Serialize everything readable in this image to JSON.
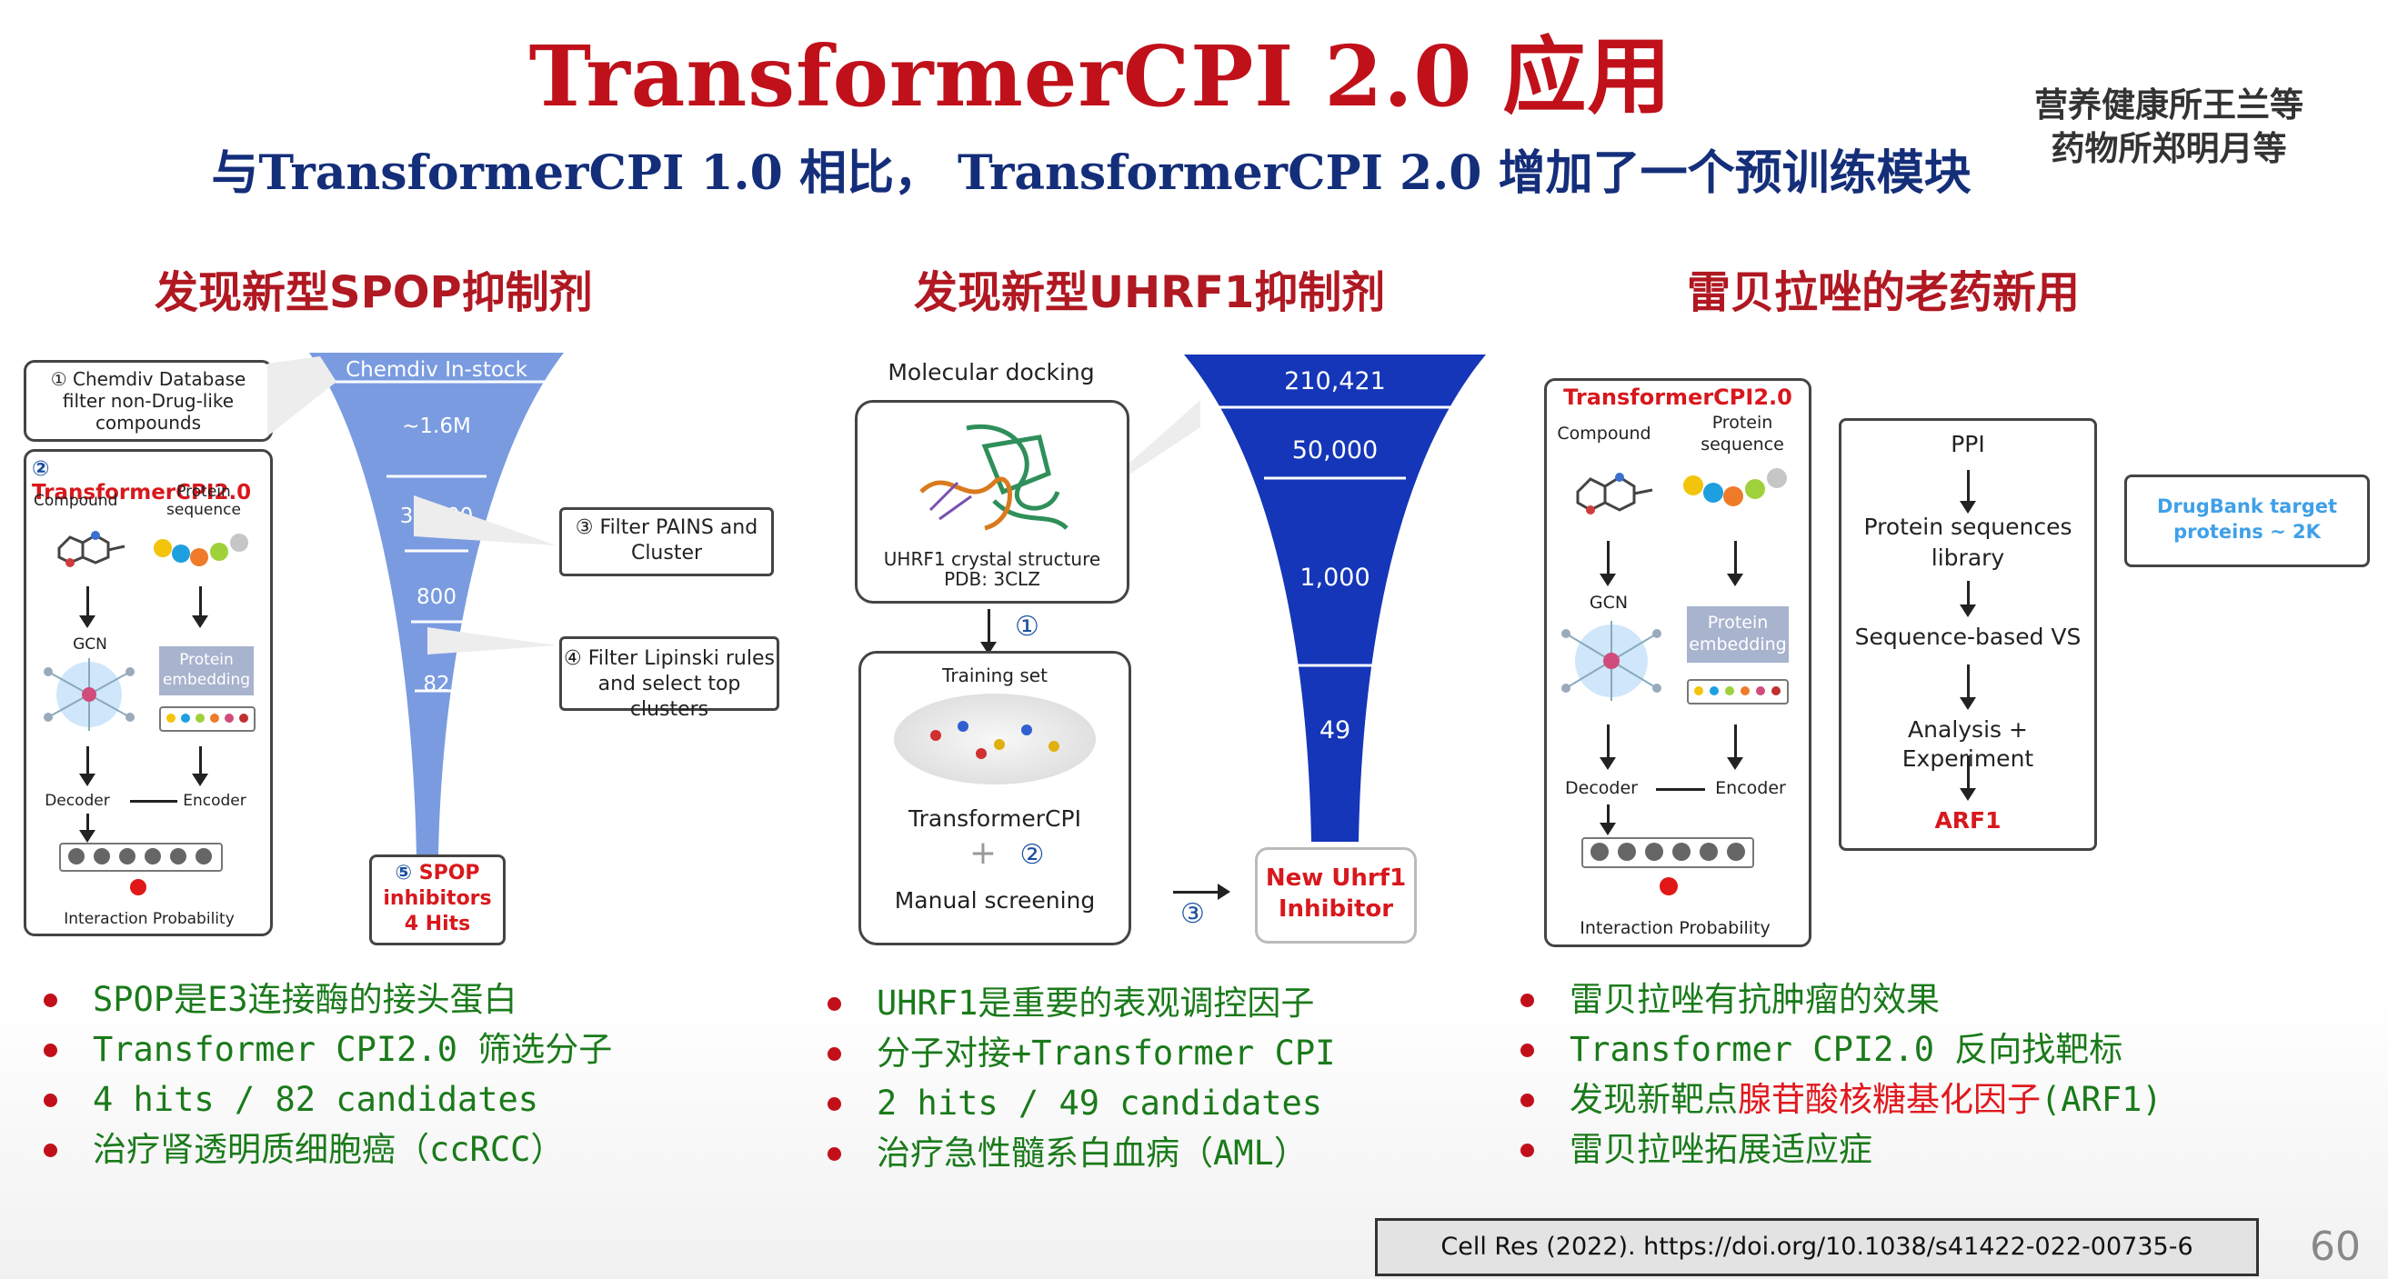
{
  "header": {
    "title": "TransformerCPI  2.0 应用",
    "authors_line1": "营养健康所王兰等",
    "authors_line2": "药物所郑明月等",
    "subtitle": "与TransformerCPI  1.0 相比，  TransformerCPI  2.0 增加了一个预训练模块"
  },
  "sections": {
    "s1": "发现新型SPOP抑制剂",
    "s2": "发现新型UHRF1抑制剂",
    "s3": "雷贝拉唑的老药新用"
  },
  "panel1": {
    "step1": "① Chemdiv Database filter non-Drug-like compounds",
    "step2_num": "②",
    "step2_label": "TransformerCPI2.0",
    "compound": "Compound",
    "protein_seq": "Protein sequence",
    "gcn": "GCN",
    "protein_embed": "Protein embedding",
    "decoder": "Decoder",
    "encoder": "Encoder",
    "interaction": "Interaction Probability",
    "funnel": [
      "Chemdiv In-stock",
      "~1.6M",
      "35,000",
      "800",
      "82"
    ],
    "step3": "③ Filter PAINS and Cluster",
    "step4": "④ Filter Lipinski rules and select top clusters",
    "step5_num": "⑤",
    "step5_label": "SPOP inhibitors",
    "step5_hits": "4 Hits"
  },
  "panel2": {
    "docking": "Molecular docking",
    "crystal": "UHRF1 crystal structure",
    "pdb": "PDB: 3CLZ",
    "n1": "①",
    "training": "Training set",
    "tcpi": "TransformerCPI",
    "plus": "+",
    "n2": "②",
    "manual": "Manual screening",
    "n3": "③",
    "funnel": [
      "210,421",
      "50,000",
      "1,000",
      "49"
    ],
    "result": "New Uhrf1 Inhibitor"
  },
  "panel3": {
    "label": "TransformerCPI2.0",
    "compound": "Compound",
    "protein_seq": "Protein sequence",
    "gcn": "GCN",
    "protein_embed": "Protein embedding",
    "decoder": "Decoder",
    "encoder": "Encoder",
    "interaction": "Interaction Probability",
    "flow": [
      "PPI",
      "Protein sequences library",
      "Sequence-based VS",
      "Analysis + Experiment",
      "ARF1"
    ],
    "drugbank": "DrugBank target proteins ~ 2K"
  },
  "bullets1": [
    "SPOP是E3连接酶的接头蛋白",
    "Transformer CPI2.0 筛选分子",
    "4 hits / 82 candidates",
    "治疗肾透明质细胞癌（ccRCC）"
  ],
  "bullets2": [
    "UHRF1是重要的表观调控因子",
    "分子对接+Transformer CPI",
    "2 hits / 49 candidates",
    "治疗急性髓系白血病（AML）"
  ],
  "bullets3": {
    "b1": "雷贝拉唑有抗肿瘤的效果",
    "b2": "Transformer CPI2.0 反向找靶标",
    "b3a": "发现新靶点",
    "b3b": "腺苷酸核糖基化因子",
    "b3c": "(ARF1)",
    "b4": "雷贝拉唑拓展适应症"
  },
  "footer": {
    "citation": "Cell Res (2022).    https://doi.org/10.1038/s41422-022-00735-6",
    "page": "60"
  },
  "colors": {
    "title": "#c0111b",
    "subtitle": "#142e7a",
    "bullet_text": "#1a7a1a",
    "funnel_light": "#7a9be0",
    "funnel_dark": "#1536b8"
  }
}
